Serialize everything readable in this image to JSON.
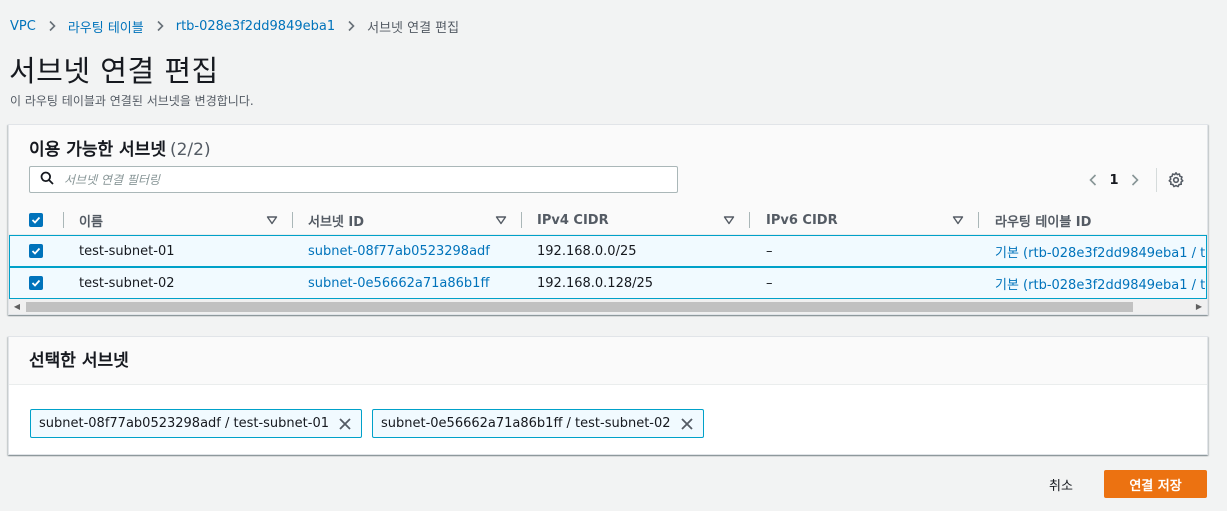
{
  "breadcrumb": {
    "items": [
      "VPC",
      "라우팅 테이블",
      "rtb-028e3f2dd9849eba1"
    ],
    "current": "서브넷 연결 편집"
  },
  "page": {
    "title": "서브넷 연결 편집",
    "description": "이 라우팅 테이블과 연결된 서브넷을 변경합니다."
  },
  "available": {
    "title": "이용 가능한 서브넷",
    "count": "(2/2)",
    "filter_placeholder": "서브넷 연결 필터링",
    "page_number": "1",
    "columns": [
      "이름",
      "서브넷 ID",
      "IPv4 CIDR",
      "IPv6 CIDR",
      "라우팅 테이블 ID"
    ],
    "rows": [
      {
        "name": "test-subnet-01",
        "subnet_id": "subnet-08f77ab0523298adf",
        "ipv4": "192.168.0.0/25",
        "ipv6": "–",
        "route_table": "기본 (rtb-028e3f2dd9849eba1 / t",
        "checked": true
      },
      {
        "name": "test-subnet-02",
        "subnet_id": "subnet-0e56662a71a86b1ff",
        "ipv4": "192.168.0.128/25",
        "ipv6": "–",
        "route_table": "기본 (rtb-028e3f2dd9849eba1 / t",
        "checked": true
      }
    ]
  },
  "selected": {
    "title": "선택한 서브넷",
    "tokens": [
      "subnet-08f77ab0523298adf / test-subnet-01",
      "subnet-0e56662a71a86b1ff / test-subnet-02"
    ]
  },
  "actions": {
    "cancel": "취소",
    "save": "연결 저장"
  },
  "colors": {
    "link": "#0073bb",
    "primary_button": "#ec7211",
    "selected_row_border": "#00a1c9",
    "selected_row_bg": "#f1faff"
  }
}
